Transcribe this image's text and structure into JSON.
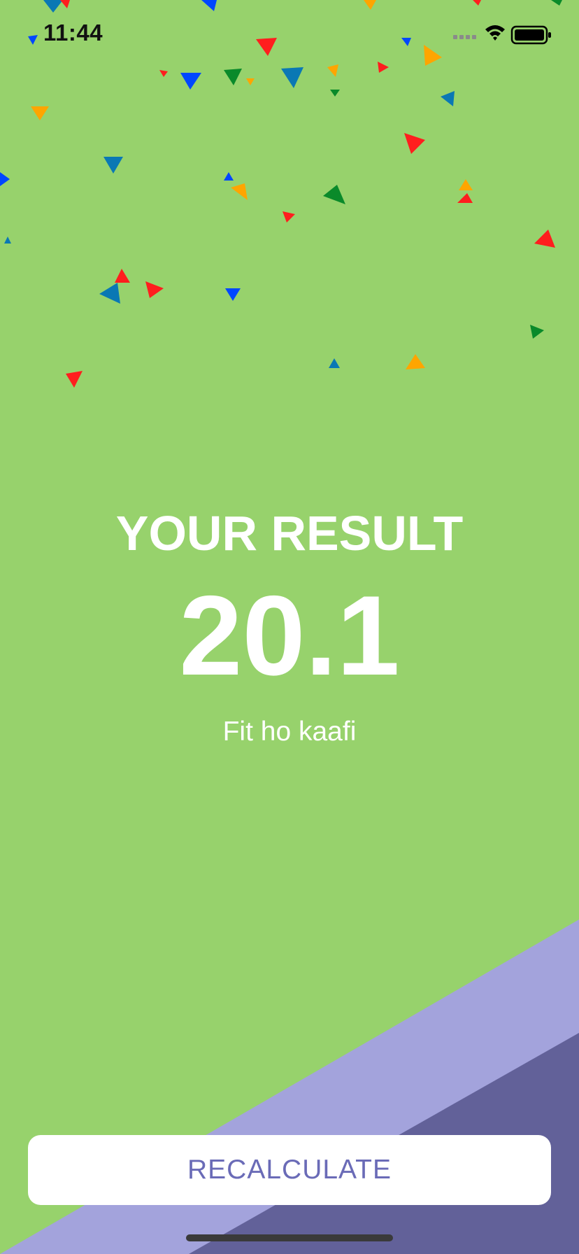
{
  "status_bar": {
    "time": "11:44"
  },
  "result": {
    "title": "YOUR RESULT",
    "value": "20.1",
    "message": "Fit ho kaafi"
  },
  "button": {
    "label": "RECALCULATE"
  },
  "colors": {
    "background": "#97D26C",
    "diagonal_light": "#A3A3DC",
    "diagonal_dark": "#626199",
    "button_text": "#6A6BB7",
    "confetti": [
      "#FF1E1E",
      "#0047FF",
      "#0A8A2A",
      "#FFA500",
      "#0A78B4"
    ]
  },
  "icons": {
    "signal": "cellular-signal-icon",
    "wifi": "wifi-icon",
    "battery": "battery-icon"
  }
}
